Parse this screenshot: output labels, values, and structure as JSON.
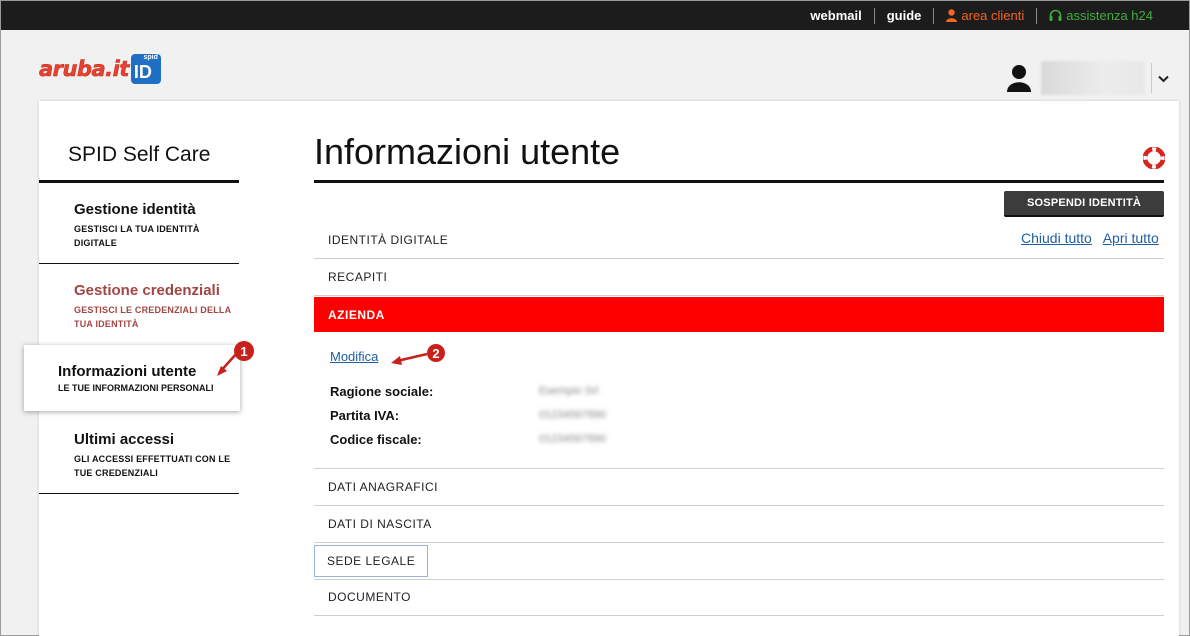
{
  "topbar": {
    "webmail": "webmail",
    "guide": "guide",
    "area_clienti": "area clienti",
    "assistenza": "assistenza h24"
  },
  "logo": {
    "brand": "aruba.it",
    "badge_top": "spid",
    "badge_id": "ID"
  },
  "user": {
    "icon": "user-icon",
    "menu_icon": "chevron-down-icon"
  },
  "sidebar": {
    "title": "SPID Self Care",
    "items": [
      {
        "label": "Gestione identità",
        "sub": "GESTISCI LA TUA IDENTITÀ DIGITALE"
      },
      {
        "label": "Gestione credenziali",
        "sub": "GESTISCI LE CREDENZIALI DELLA TUA IDENTITÀ"
      },
      {
        "label": "Informazioni utente",
        "sub": "LE TUE INFORMAZIONI PERSONALI"
      },
      {
        "label": "Ultimi accessi",
        "sub": "GLI ACCESSI EFFETTUATI CON LE TUE CREDENZIALI"
      }
    ]
  },
  "annotations": {
    "step1": "1",
    "step2": "2"
  },
  "main": {
    "title": "Informazioni utente",
    "help_icon": "lifebuoy-icon",
    "suspend_label": "SOSPENDI IDENTITÀ",
    "close_all": "Chiudi tutto",
    "open_all": "Apri tutto",
    "sections": [
      "IDENTITÀ DIGITALE",
      "RECAPITI",
      "AZIENDA",
      "DATI ANAGRAFICI",
      "DATI DI NASCITA",
      "SEDE LEGALE",
      "DOCUMENTO"
    ],
    "azienda": {
      "edit_link": "Modifica",
      "fields": [
        {
          "label": "Ragione sociale:",
          "value": "Esempio Srl"
        },
        {
          "label": "Partita IVA:",
          "value": "01234567890"
        },
        {
          "label": "Codice fiscale:",
          "value": "01234567890"
        }
      ]
    }
  },
  "colors": {
    "accent_red": "#ff0000",
    "link_blue": "#1f5fa3",
    "topbar_bg": "#1c1c1c"
  }
}
